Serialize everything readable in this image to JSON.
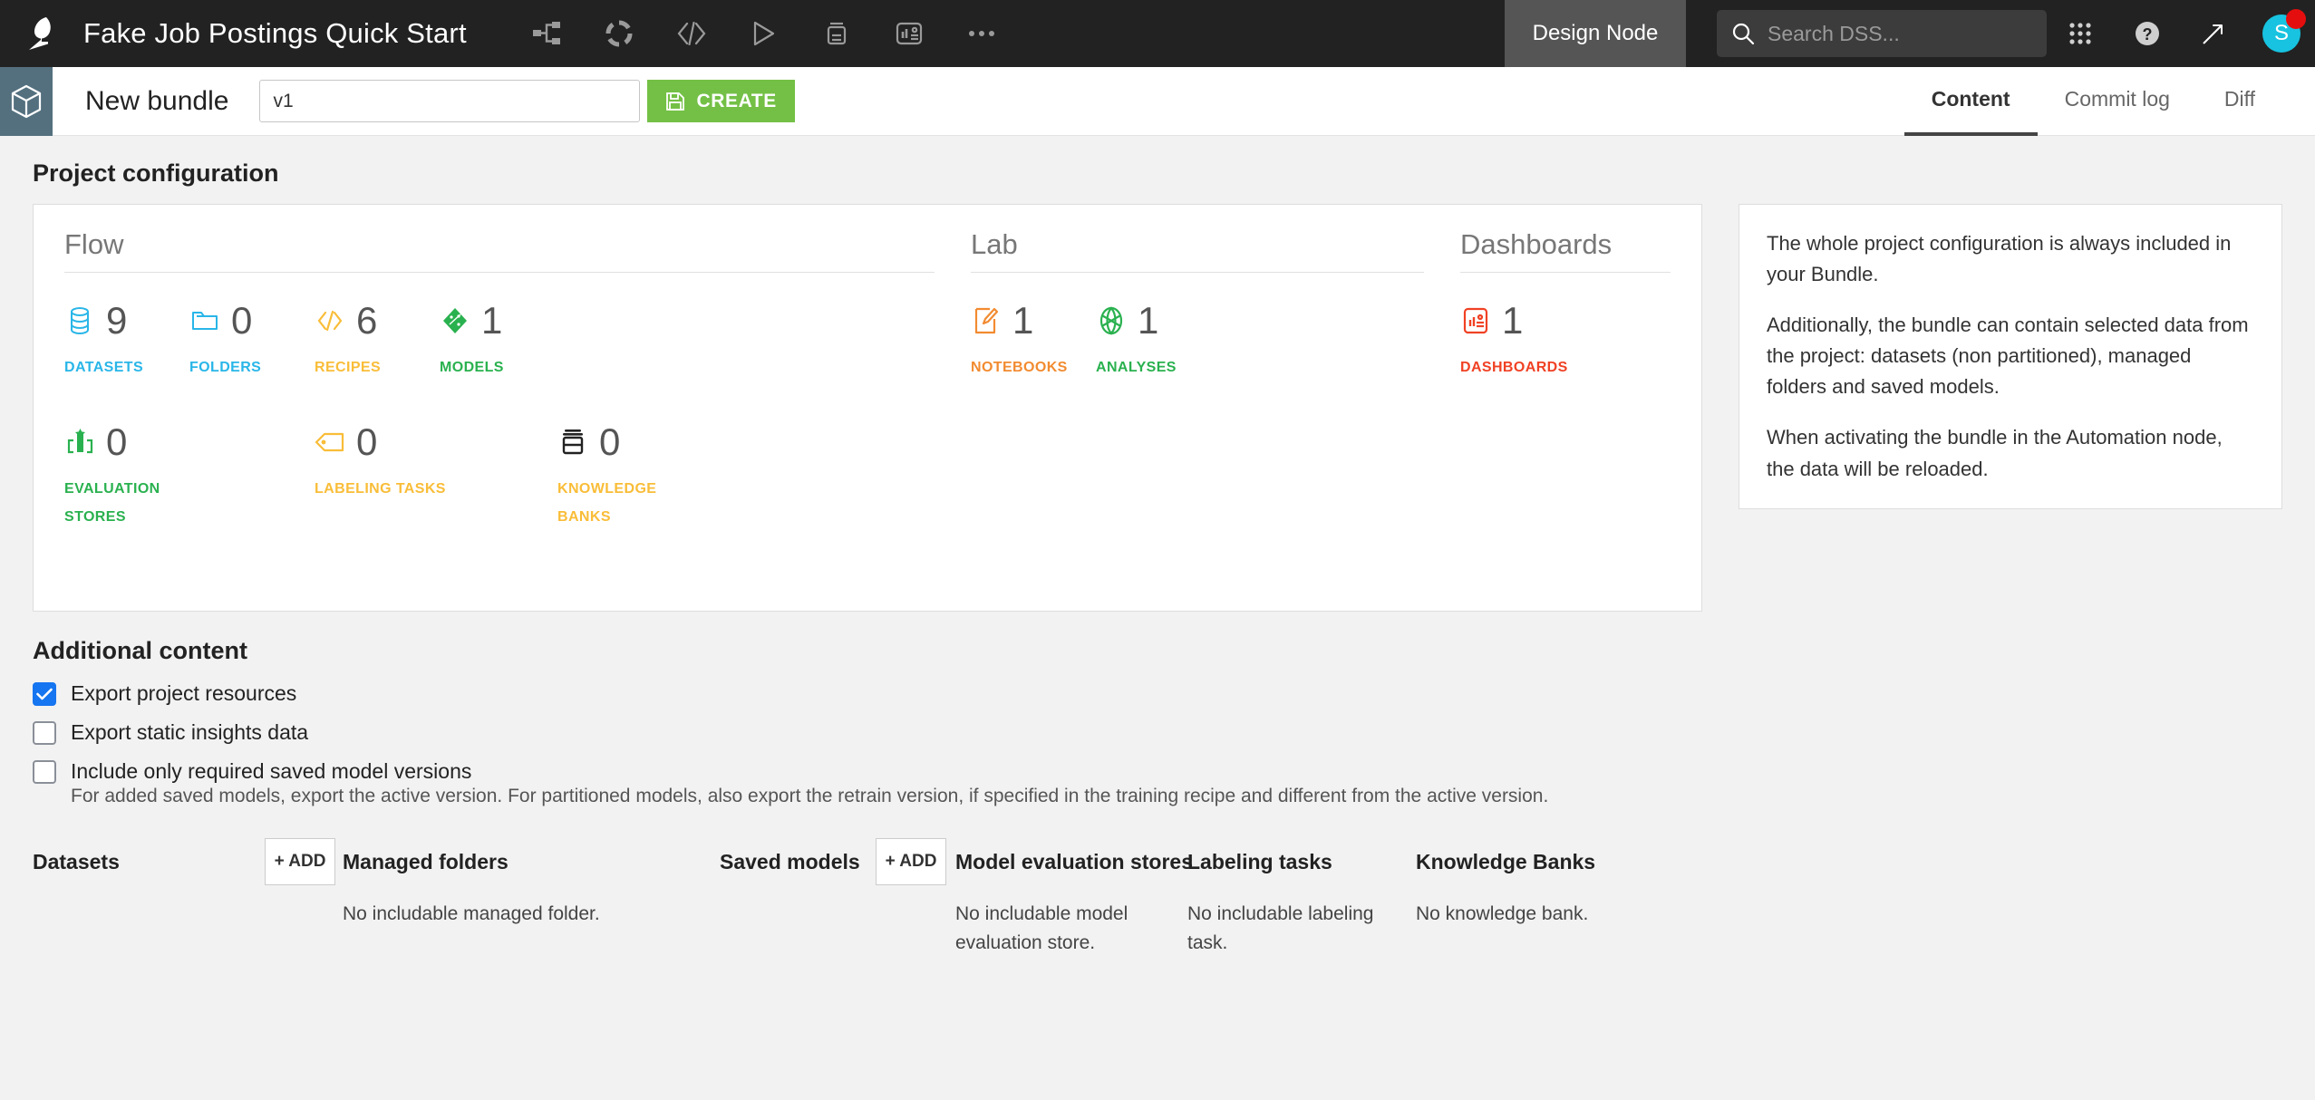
{
  "topbar": {
    "logo_icon": "dataiku-bird-logo-icon",
    "project_title": "Fake Job Postings Quick Start",
    "nav_icons": [
      {
        "name": "flow-icon",
        "label": "Flow"
      },
      {
        "name": "lab-icon",
        "label": "Lab"
      },
      {
        "name": "code-icon",
        "label": "Code"
      },
      {
        "name": "automation-icon",
        "label": "Automation"
      },
      {
        "name": "jobs-icon",
        "label": "Jobs"
      },
      {
        "name": "dashboards-icon",
        "label": "Dashboards"
      },
      {
        "name": "more-icon",
        "label": "More"
      }
    ],
    "node_label": "Design Node",
    "search": {
      "placeholder": "Search DSS...",
      "value": "",
      "icon": "search-icon"
    },
    "apps_icon": "apps-grid-icon",
    "help_icon": "help-circle-icon",
    "trending_icon": "trending-up-icon",
    "avatar_initial": "S",
    "avatar_color": "#17c3e0",
    "notification_color": "#e50e0e",
    "has_notification": true
  },
  "subbar": {
    "bundle_icon": "bundle-cube-icon",
    "bundle_icon_bg": "#54707f",
    "title": "New bundle",
    "version_input": {
      "value": "v1",
      "placeholder": ""
    },
    "create_button": {
      "label": "CREATE",
      "icon": "save-disk-icon",
      "color": "#74c046"
    },
    "tabs": [
      {
        "label": "Content",
        "active": true
      },
      {
        "label": "Commit log",
        "active": false
      },
      {
        "label": "Diff",
        "active": false
      }
    ]
  },
  "main": {
    "project_configuration_title": "Project configuration",
    "groups": [
      {
        "title": "Flow",
        "rows": [
          [
            {
              "count": "9",
              "label": "DATASETS",
              "color": "#29b6e8",
              "icon": "dataset-stack-icon"
            },
            {
              "count": "0",
              "label": "FOLDERS",
              "color": "#29b6e8",
              "icon": "folder-icon"
            },
            {
              "count": "6",
              "label": "RECIPES",
              "color": "#f9bd38",
              "icon": "code-brackets-icon"
            },
            {
              "count": "1",
              "label": "MODELS",
              "color": "#2ab14f",
              "icon": "model-diamond-icon"
            }
          ],
          [
            {
              "count": "0",
              "label": "EVALUATION STORES",
              "color": "#2ab14f",
              "icon": "evaluation-store-icon"
            },
            {
              "count": "0",
              "label": "LABELING TASKS",
              "color": "#f9bd38",
              "icon": "label-tag-icon"
            },
            {
              "count": "0",
              "label": "KNOWLEDGE BANKS",
              "color": "#f9bd38",
              "icon": "knowledge-bank-icon"
            }
          ]
        ]
      },
      {
        "title": "Lab",
        "rows": [
          [
            {
              "count": "1",
              "label": "NOTEBOOKS",
              "color": "#f28b30",
              "icon": "notebook-pencil-icon"
            },
            {
              "count": "1",
              "label": "ANALYSES",
              "color": "#2ab14f",
              "icon": "analysis-aperture-icon"
            }
          ]
        ]
      },
      {
        "title": "Dashboards",
        "rows": [
          [
            {
              "count": "1",
              "label": "DASHBOARDS",
              "color": "#f04124",
              "icon": "dashboard-chart-icon"
            }
          ]
        ]
      }
    ],
    "info_paragraphs": [
      "The whole project configuration is always included in your Bundle.",
      "Additionally, the bundle can contain selected data from the project: datasets (non partitioned), managed folders and saved models.",
      "When activating the bundle in the Automation node, the data will be reloaded."
    ],
    "additional_content_title": "Additional content",
    "checkboxes": [
      {
        "label": "Export project resources",
        "checked": true
      },
      {
        "label": "Export static insights data",
        "checked": false
      },
      {
        "label": "Include only required saved model versions",
        "checked": false
      }
    ],
    "checkbox_helper": "For added saved models, export the active version. For partitioned models, also export the retrain version, if specified in the training recipe and different from the active version.",
    "bottom_columns": [
      {
        "title": "Datasets",
        "add_label": "+ ADD",
        "has_add": true,
        "empty": ""
      },
      {
        "title": "Managed folders",
        "add_label": "+ ADD",
        "has_add": false,
        "empty": "No includable managed folder."
      },
      {
        "title": "Saved models",
        "add_label": "+ ADD",
        "has_add": true,
        "empty": ""
      },
      {
        "title": "Model evaluation stores",
        "add_label": "",
        "has_add": false,
        "empty": "No includable model evaluation store."
      },
      {
        "title": "Labeling tasks",
        "add_label": "",
        "has_add": false,
        "empty": "No includable labeling task."
      },
      {
        "title": "Knowledge Banks",
        "add_label": "",
        "has_add": false,
        "empty": "No knowledge bank."
      }
    ]
  }
}
